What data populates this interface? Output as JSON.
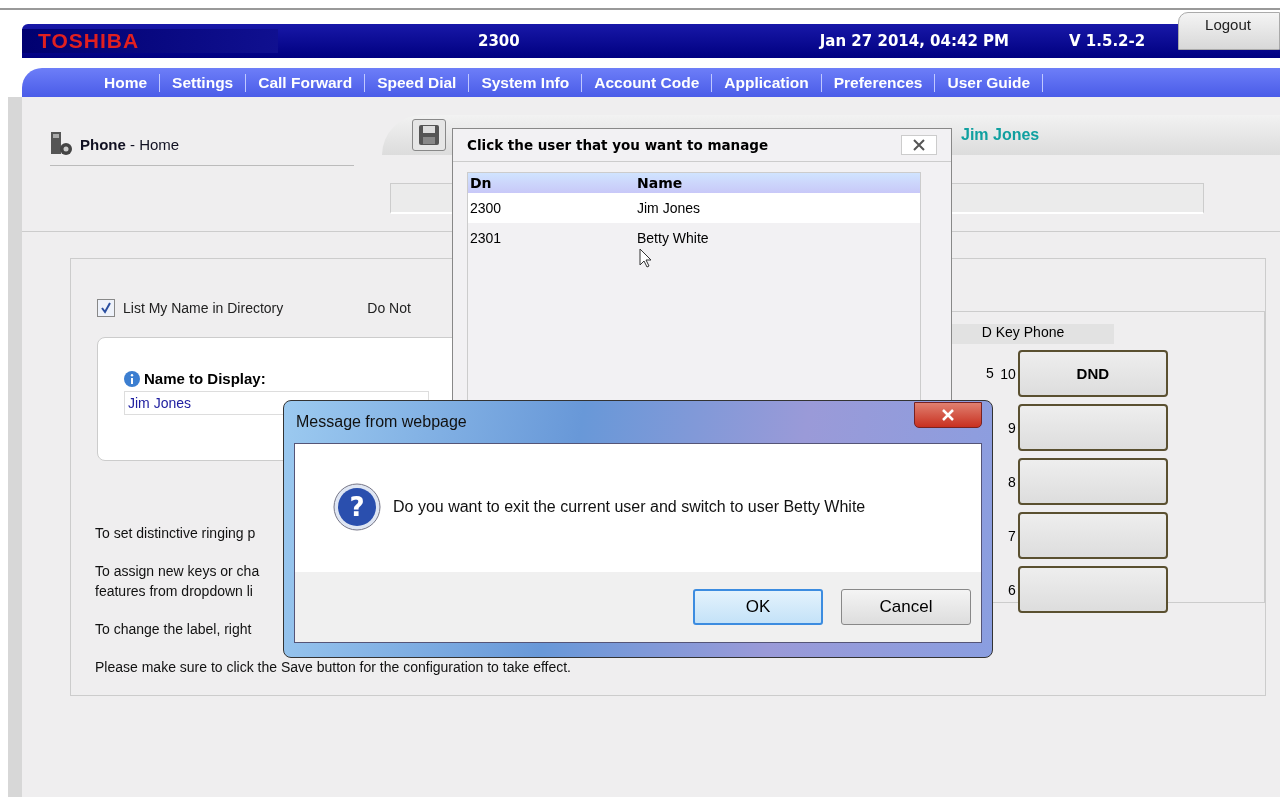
{
  "header": {
    "logo": "TOSHIBA",
    "extension": "2300",
    "datetime": "Jan 27 2014, 04:42 PM",
    "version": "V 1.5.2-2",
    "logout": "Logout"
  },
  "nav": [
    "Home",
    "Settings",
    "Call Forward",
    "Speed Dial",
    "System Info",
    "Account Code",
    "Application",
    "Preferences",
    "User Guide"
  ],
  "page": {
    "title": "Phone",
    "separator": "-",
    "subtitle": "Home",
    "managed_account": "Jim Jones"
  },
  "settings": {
    "list_in_directory": {
      "label": "List My Name in Directory",
      "checked": true
    },
    "dnd_label": "Do Not",
    "name_label": "Name to Display:",
    "name_value": "Jim Jones"
  },
  "key_phone": {
    "title": "D Key Phone",
    "left_number": "5",
    "keys": [
      {
        "number": "10",
        "label": "DND"
      },
      {
        "number": "9"
      },
      {
        "number": "8"
      },
      {
        "number": "7"
      },
      {
        "number": "6"
      }
    ]
  },
  "instructions": [
    "To set distinctive ringing p",
    "To assign new keys or cha\nfeatures from dropdown li",
    "To change the label, right",
    "Please make sure to click the Save button for the configuration to take effect."
  ],
  "user_picker": {
    "title": "Click the user that you want to manage",
    "columns": [
      "Dn",
      "Name"
    ],
    "rows": [
      {
        "dn": "2300",
        "name": "Jim Jones",
        "selected": true
      },
      {
        "dn": "2301",
        "name": "Betty White",
        "selected": false
      }
    ]
  },
  "message_box": {
    "title": "Message from webpage",
    "icon_glyph": "?",
    "message": "Do you want to exit the current user and switch to user Betty White",
    "buttons": [
      "OK",
      "Cancel"
    ]
  }
}
